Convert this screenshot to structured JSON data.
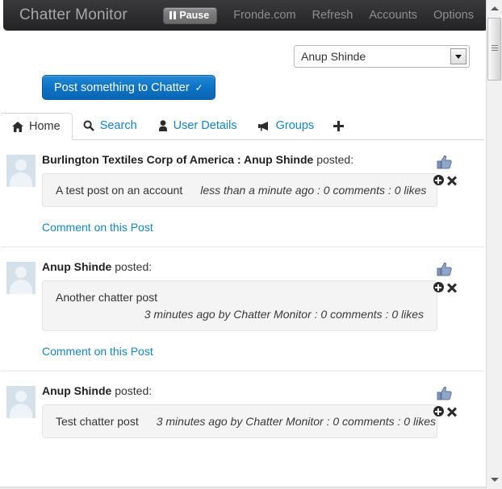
{
  "header": {
    "title": "Chatter Monitor",
    "pause_label": "Pause",
    "pause_icon": "pause-icon",
    "nav": [
      {
        "label": "Fronde.com",
        "name": "nav-fronde"
      },
      {
        "label": "Refresh",
        "name": "nav-refresh"
      },
      {
        "label": "Accounts",
        "name": "nav-accounts"
      },
      {
        "label": "Options",
        "name": "nav-options"
      }
    ]
  },
  "account_select": {
    "value": "Anup Shinde",
    "arrow_icon": "chevron-down-icon",
    "options": [
      "Anup Shinde"
    ]
  },
  "post_button": {
    "label": "Post something to Chatter",
    "chevron": "✔",
    "chevron_icon": "chevron-down-icon"
  },
  "tabs": [
    {
      "label": "Home",
      "icon": "home-icon",
      "active": true
    },
    {
      "label": "Search",
      "icon": "search-icon",
      "active": false
    },
    {
      "label": "User Details",
      "icon": "user-icon",
      "active": false
    },
    {
      "label": "Groups",
      "icon": "megaphone-icon",
      "active": false
    }
  ],
  "add_tab": {
    "icon": "plus-icon",
    "label": ""
  },
  "feed": {
    "comment_link_label": "Comment on this Post",
    "actions": {
      "like_icon": "thumbs-up-icon",
      "add_icon": "circle-plus-icon",
      "remove_icon": "close-icon"
    },
    "posts": [
      {
        "account": "Burlington Textiles Corp of America",
        "author": "Anup Shinde",
        "separator": " : ",
        "posted_label": "posted:",
        "body": "A test post on an account",
        "meta": "less than a minute ago : 0 comments : 0 likes",
        "layout": "inline",
        "show_comment_link": true,
        "avatar_icon": "avatar"
      },
      {
        "account": "",
        "author": "Anup Shinde",
        "separator": "",
        "posted_label": "posted:",
        "body": "Another chatter post",
        "meta": "3 minutes ago by Chatter Monitor : 0 comments : 0 likes",
        "layout": "stacked",
        "show_comment_link": true,
        "avatar_icon": "avatar"
      },
      {
        "account": "",
        "author": "Anup Shinde",
        "separator": "",
        "posted_label": "posted:",
        "body": "Test chatter post",
        "meta": "3 minutes ago by Chatter Monitor : 0 comments : 0 likes",
        "layout": "inline",
        "show_comment_link": false,
        "avatar_icon": "avatar"
      }
    ]
  },
  "scrollbar": {
    "up_icon": "triangle-up-icon",
    "down_icon": "triangle-down-icon",
    "thumb": "scroll-thumb"
  },
  "colors": {
    "header_bg": "#2d2d2f",
    "link_blue": "#1583c7",
    "button_blue": "#0d74c6",
    "bubble_bg": "#f4f4f4",
    "avatar_bg": "#d4e0ea"
  }
}
